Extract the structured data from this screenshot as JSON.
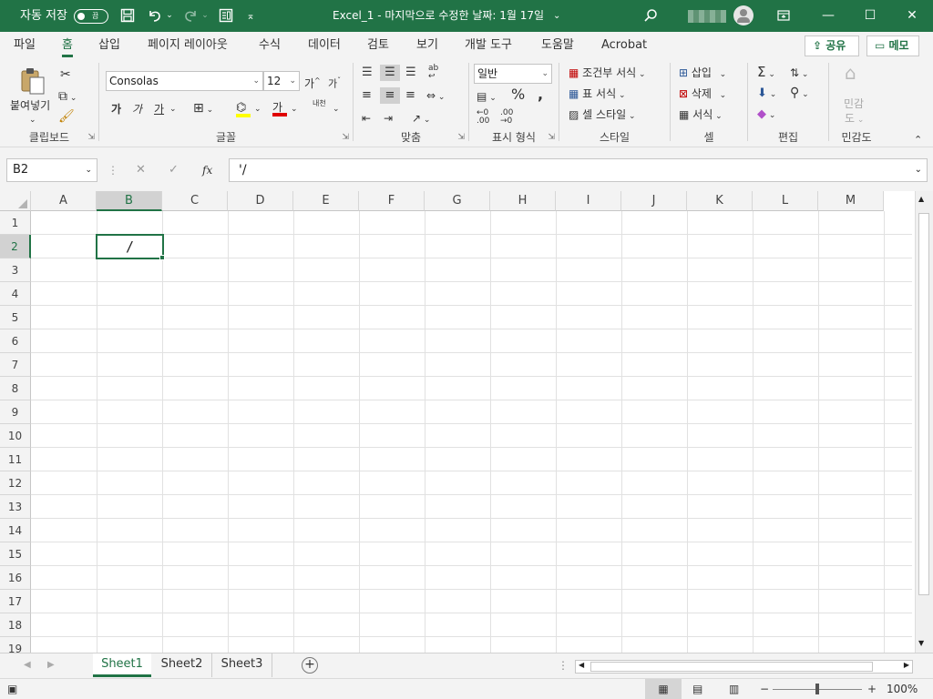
{
  "titlebar": {
    "autosave_label": "자동 저장",
    "autosave_state": "끔",
    "title": "Excel_1 - 마지막으로 수정한 날짜: 1월 17일",
    "title_caret": "⌄",
    "icons": [
      "save-icon",
      "undo-icon",
      "redo-icon",
      "customize-icon",
      "search-icon",
      "ribbon-display-icon",
      "minimize-icon",
      "maximize-icon",
      "close-icon"
    ]
  },
  "tabs": [
    {
      "label": "파일"
    },
    {
      "label": "홈",
      "active": true
    },
    {
      "label": "삽입"
    },
    {
      "label": "페이지 레이아웃"
    },
    {
      "label": "수식"
    },
    {
      "label": "데이터"
    },
    {
      "label": "검토"
    },
    {
      "label": "보기"
    },
    {
      "label": "개발 도구"
    },
    {
      "label": "도움말"
    },
    {
      "label": "Acrobat"
    }
  ],
  "share_label": "공유",
  "comments_label": "메모",
  "ribbon": {
    "clipboard": {
      "label": "클립보드",
      "paste": "붙여넣기"
    },
    "font": {
      "label": "글꼴",
      "name": "Consolas",
      "size": "12",
      "bold": "가",
      "italic": "가",
      "underline": "가",
      "fontcolor": "가",
      "grow": "가",
      "shrink": "가",
      "phonetic": "내천",
      "fill_color": "#ffff00",
      "text_color": "#e00000"
    },
    "alignment": {
      "label": "맞춤"
    },
    "number": {
      "label": "표시 형식",
      "format": "일반"
    },
    "styles": {
      "label": "스타일",
      "conditional": "조건부 서식",
      "table": "표 서식",
      "cell": "셀 스타일"
    },
    "cells": {
      "label": "셀",
      "insert": "삽입",
      "delete": "삭제",
      "format": "서식"
    },
    "editing": {
      "label": "편집"
    },
    "sensitivity": {
      "label": "민감도",
      "btn_line1": "민감",
      "btn_line2": "도"
    }
  },
  "formula_bar": {
    "name_box": "B2",
    "fx": "fx",
    "content": "'/"
  },
  "grid": {
    "columns": [
      "A",
      "B",
      "C",
      "D",
      "E",
      "F",
      "G",
      "H",
      "I",
      "J",
      "K",
      "L",
      "M"
    ],
    "rows": [
      "1",
      "2",
      "3",
      "4",
      "5",
      "6",
      "7",
      "8",
      "9",
      "10",
      "11",
      "12",
      "13",
      "14",
      "15",
      "16",
      "17",
      "18",
      "19"
    ],
    "active_cell": "B2",
    "active_value": "/"
  },
  "sheets": [
    {
      "label": "Sheet1",
      "active": true
    },
    {
      "label": "Sheet2"
    },
    {
      "label": "Sheet3"
    }
  ],
  "status": {
    "zoom": "100%"
  }
}
